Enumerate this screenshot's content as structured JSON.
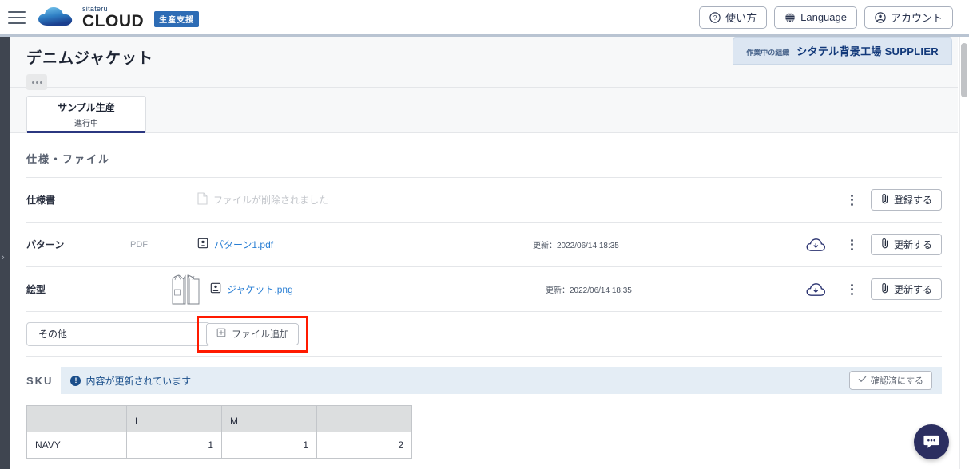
{
  "header": {
    "menu_icon": "hamburger-icon",
    "logo_top": "sitateru",
    "logo_main": "CLOUD",
    "logo_badge": "生産支援",
    "buttons": [
      {
        "label": "使い方",
        "icon": "question-circle-icon"
      },
      {
        "label": "Language",
        "icon": "globe-icon"
      },
      {
        "label": "アカウント",
        "icon": "account-circle-icon"
      }
    ]
  },
  "title_block": {
    "title": "デニムジャケット",
    "more_button": "more-options",
    "org_label": "作業中の組織",
    "org_name": "シタテル背景工場 SUPPLIER"
  },
  "tabs": [
    {
      "name": "サンプル生産",
      "sub": "進行中",
      "active": true
    }
  ],
  "files_section": {
    "heading": "仕様・ファイル",
    "rows": [
      {
        "label": "仕様書",
        "kind": "",
        "file_name": "ファイルが削除されました",
        "file_state": "deleted",
        "date": "",
        "has_download": false,
        "action_label": "登録する"
      },
      {
        "label": "パターン",
        "kind": "PDF",
        "file_name": "パターン1.pdf",
        "file_state": "link",
        "date": "更新：2022/06/14 18:35",
        "has_download": true,
        "action_label": "更新する"
      },
      {
        "label": "絵型",
        "kind": "",
        "file_name": "ジャケット.png",
        "file_state": "link",
        "date": "更新：2022/06/14 18:35",
        "has_download": true,
        "action_label": "更新する",
        "thumbnail": "jacket-technical-drawing"
      }
    ],
    "other_row": {
      "select_value": "その他",
      "add_button_label": "ファイル追加",
      "add_button_icon": "add-file-icon",
      "highlighted": true,
      "highlight_color": "#ff1a00"
    }
  },
  "sku_section": {
    "label": "SKU",
    "note": "内容が更新されています",
    "note_icon": "info-icon",
    "confirm_button": "確認済にする",
    "confirm_icon": "check-icon",
    "table": {
      "headers": [
        "",
        "L",
        "M",
        ""
      ],
      "rows": [
        [
          "NAVY",
          "1",
          "1",
          "2"
        ]
      ]
    }
  },
  "chat": {
    "icon": "chat-bubble-icon"
  },
  "colors": {
    "accent": "#2b3780",
    "link": "#2a7fd4",
    "highlight": "#ff1a00",
    "org_bg": "#dce6f2",
    "note_bg": "#e4edf5",
    "rail": "#3f4550"
  }
}
